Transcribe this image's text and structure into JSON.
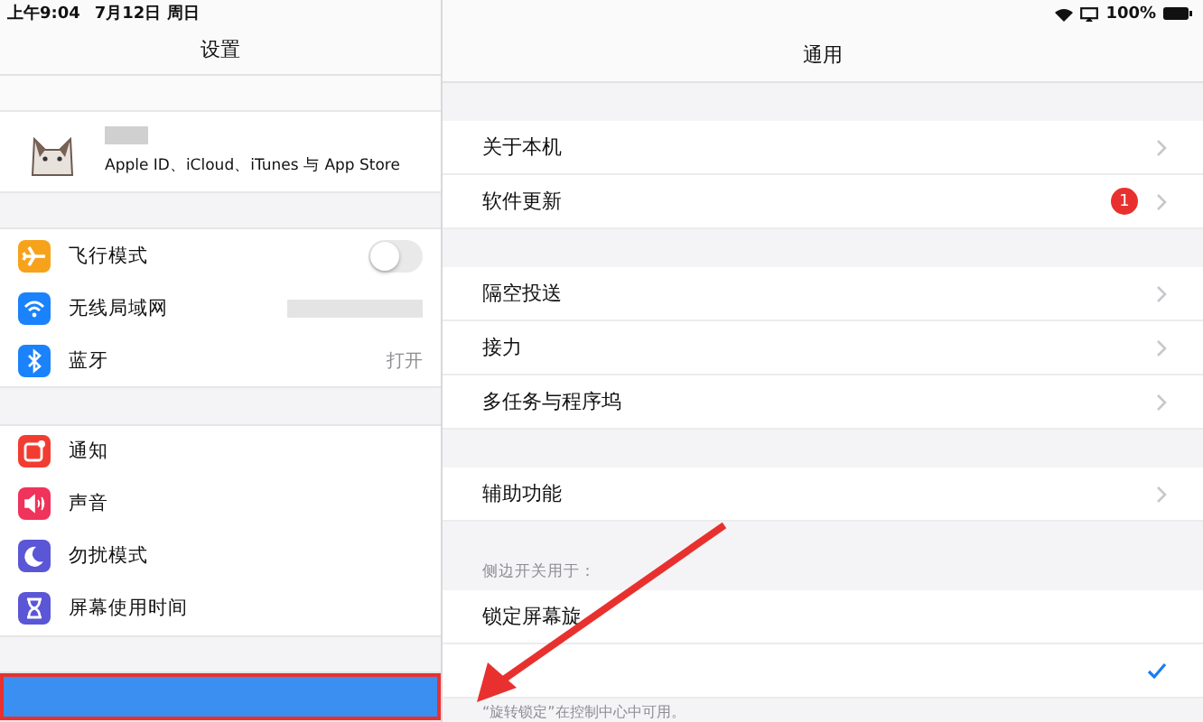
{
  "status_bar": {
    "time": "上午9:04",
    "date": "7月12日 周日",
    "battery": "100%"
  },
  "sidebar": {
    "title": "设置",
    "profile": {
      "subtitle": "Apple ID、iCloud、iTunes 与 App Store"
    },
    "groups": [
      {
        "items": [
          {
            "label": "飞行模式",
            "kind": "toggle",
            "on": false,
            "color": "#f7a21b",
            "selected": false
          },
          {
            "label": "无线局域网",
            "kind": "blurred",
            "color": "#1a82fb",
            "selected": false
          },
          {
            "label": "蓝牙",
            "kind": "value",
            "value": "打开",
            "color": "#1a82fb",
            "selected": false
          }
        ]
      },
      {
        "items": [
          {
            "label": "通知",
            "kind": "plain",
            "color": "#f23c32",
            "selected": false
          },
          {
            "label": "声音",
            "kind": "plain",
            "color": "#f0335a",
            "selected": false
          },
          {
            "label": "勿扰模式",
            "kind": "plain",
            "color": "#5a56d6",
            "selected": false
          },
          {
            "label": "屏幕使用时间",
            "kind": "plain",
            "color": "#5a56d6",
            "selected": false
          }
        ]
      },
      {
        "items": [
          {
            "kind": "cut",
            "selected": true
          }
        ]
      }
    ]
  },
  "detail": {
    "title": "通用",
    "groups": [
      {
        "items": [
          {
            "label": "关于本机",
            "kind": "link"
          },
          {
            "label": "软件更新",
            "kind": "link",
            "badge": "1"
          }
        ]
      },
      {
        "items": [
          {
            "label": "隔空投送",
            "kind": "link"
          },
          {
            "label": "接力",
            "kind": "link"
          },
          {
            "label": "多任务与程序坞",
            "kind": "link"
          }
        ]
      },
      {
        "items": [
          {
            "label": "辅助功能",
            "kind": "link"
          }
        ]
      },
      {
        "header": "侧边开关用于：",
        "items": [
          {
            "label": "锁定屏幕旋",
            "kind": "option",
            "checked": false
          },
          {
            "kind": "option",
            "checked": true
          }
        ],
        "footer": "“旋转锁定”在控制中心中可用。"
      }
    ]
  }
}
